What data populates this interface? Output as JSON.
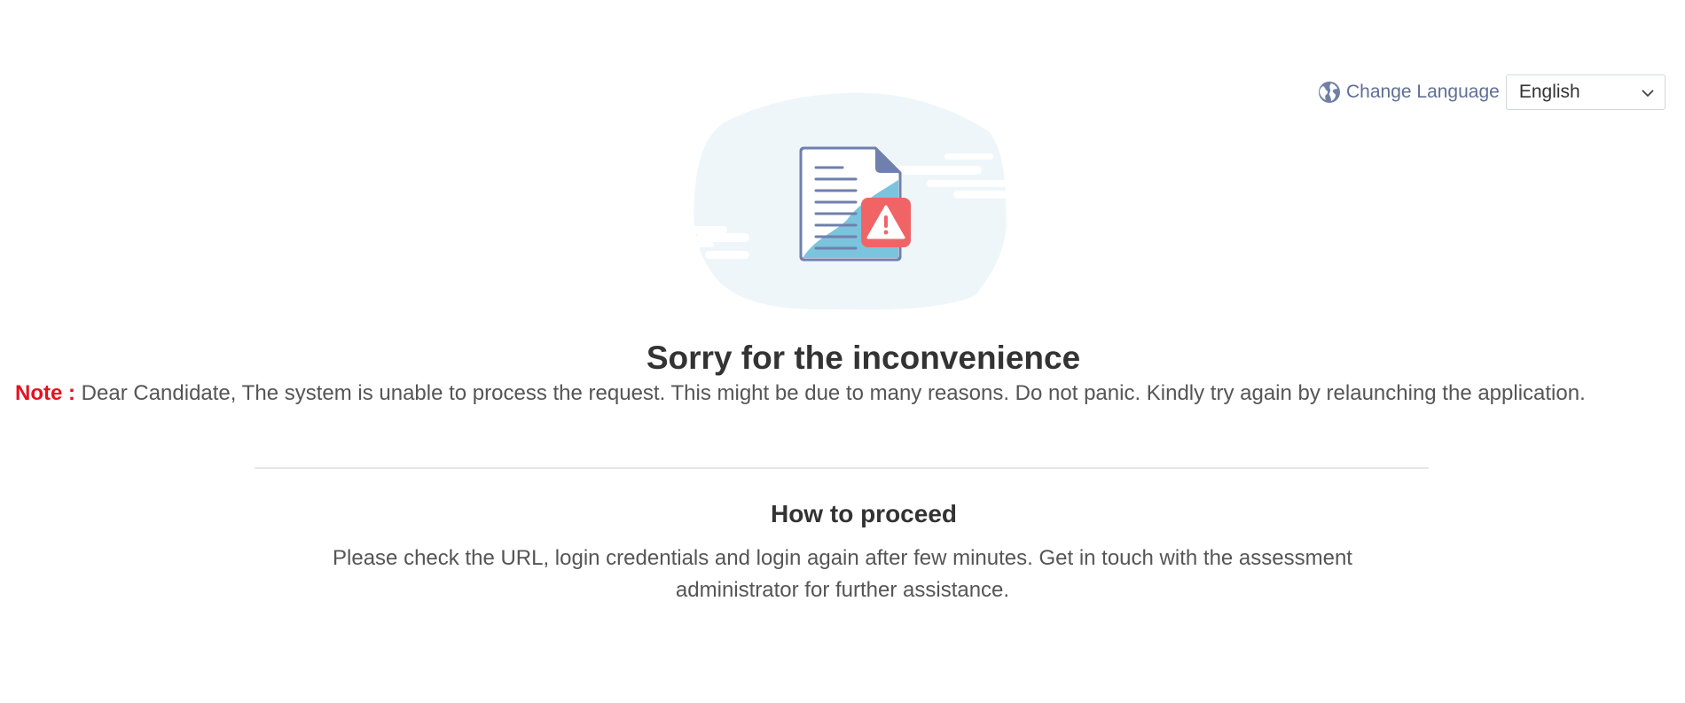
{
  "language": {
    "link_label": "Change Language",
    "selected": "English",
    "icon": "globe-icon"
  },
  "illustration": {
    "icon": "document-warning-icon",
    "colors": {
      "blob": "#eef6fa",
      "paper_outline": "#6f80ad",
      "paper_fill": "#7bc4dd",
      "warning": "#f06466"
    }
  },
  "error": {
    "title": "Sorry for the inconvenience",
    "note_label": "Note :",
    "note_text": "Dear Candidate, The system is unable to process the request. This might be due to many reasons. Do not panic. Kindly try again by relaunching the application."
  },
  "proceed": {
    "title": "How to proceed",
    "text": "Please check the URL, login credentials and login again after few minutes. Get in touch with the assessment administrator for further assistance."
  }
}
